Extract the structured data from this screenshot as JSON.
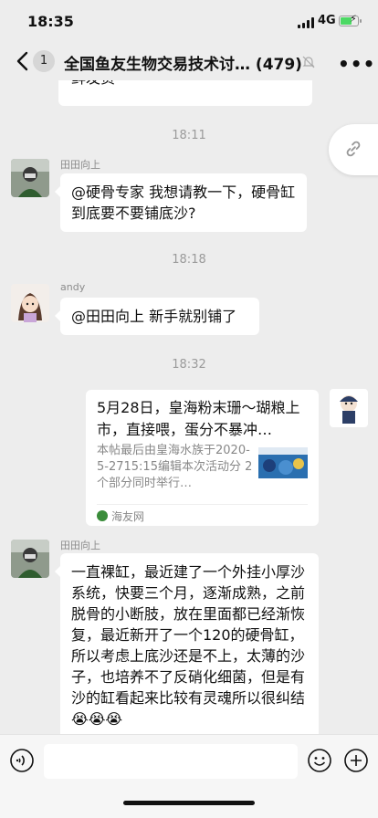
{
  "status": {
    "time": "18:35",
    "network": "4G"
  },
  "header": {
    "unread_count": "1",
    "title": "全国鱼友生物交易技术讨…",
    "member_count": "(479)"
  },
  "messages": [
    {
      "type": "text",
      "text": "鲜发货"
    },
    {
      "type": "time",
      "text": "18:11"
    },
    {
      "type": "text",
      "sender": "田田向上",
      "text": "@硬骨专家 我想请教一下，硬骨缸到底要不要铺底沙?"
    },
    {
      "type": "time",
      "text": "18:18"
    },
    {
      "type": "text",
      "sender": "andy",
      "text": "@田田向上 新手就别铺了"
    },
    {
      "type": "time",
      "text": "18:32"
    },
    {
      "type": "link",
      "title": "5月28日，皇海粉末珊～瑚粮上市，直接喂，蛋分不暴冲…",
      "desc": "本帖最后由皇海水族于2020-5-2715:15编辑本次活动分 2个部分同时举行…",
      "source": "海友网"
    },
    {
      "type": "text",
      "sender": "田田向上",
      "text": "一直裸缸，最近建了一个外挂小厚沙系统，快要三个月，逐渐成熟，之前脱骨的小断肢，放在里面都已经渐恢复，最近新开了一个120的硬骨缸，所以考虑上底沙还是不上，太薄的沙子，也培养不了反硝化细菌，但是有沙的缸看起来比较有灵魂所以很纠结😭😭😭"
    }
  ],
  "icons": {
    "back": "chevron-left-icon",
    "mute": "bell-off-icon",
    "more": "more-dots-icon",
    "link": "link-icon",
    "voice": "voice-icon",
    "emoji": "emoji-icon",
    "plus": "plus-circle-icon"
  },
  "input": {
    "value": ""
  }
}
